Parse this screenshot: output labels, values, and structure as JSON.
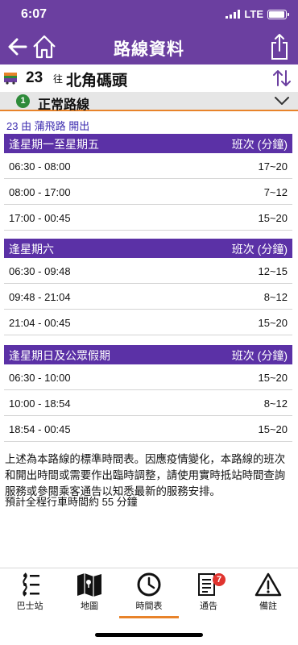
{
  "status": {
    "time": "6:07",
    "network": "LTE"
  },
  "nav": {
    "title": "路線資料"
  },
  "route": {
    "number": "23",
    "direction_prefix": "往",
    "destination": "北角碼頭"
  },
  "variant": {
    "badge": "1",
    "label": "正常路線"
  },
  "departure_note": "23 由 蒲飛路 開出",
  "frequency_header": "班次 (分鐘)",
  "timetables": [
    {
      "title": "逢星期一至星期五",
      "rows": [
        {
          "time": "06:30 - 08:00",
          "freq": "17~20"
        },
        {
          "time": "08:00 - 17:00",
          "freq": "7~12"
        },
        {
          "time": "17:00 - 00:45",
          "freq": "15~20"
        }
      ]
    },
    {
      "title": "逢星期六",
      "rows": [
        {
          "time": "06:30 - 09:48",
          "freq": "12~15"
        },
        {
          "time": "09:48 - 21:04",
          "freq": "8~12"
        },
        {
          "time": "21:04 - 00:45",
          "freq": "15~20"
        }
      ]
    },
    {
      "title": "逢星期日及公眾假期",
      "rows": [
        {
          "time": "06:30 - 10:00",
          "freq": "15~20"
        },
        {
          "time": "10:00 - 18:54",
          "freq": "8~12"
        },
        {
          "time": "18:54 - 00:45",
          "freq": "15~20"
        }
      ]
    }
  ],
  "notice": "上述為本路線的標準時間表。因應疫情變化，本路線的班次和開出時間或需要作出臨時調整，請使用實時抵站時間查詢服務或參閱乘客通告以知悉最新的服務安排。",
  "journey_time": "預計全程行車時間約 55 分鐘",
  "tabs": [
    {
      "label": "巴士站",
      "icon": "bus-stops-icon"
    },
    {
      "label": "地圖",
      "icon": "map-icon"
    },
    {
      "label": "時間表",
      "icon": "clock-icon",
      "active": true
    },
    {
      "label": "通告",
      "icon": "notice-icon",
      "badge": "7"
    },
    {
      "label": "備註",
      "icon": "warning-icon"
    }
  ],
  "colors": {
    "header": "#6b3fa0",
    "table_header": "#5b31a6",
    "accent": "#e8832a",
    "link": "#3d2cb0",
    "badge": "#e0342f",
    "route_badge": "#2e8b3a"
  }
}
